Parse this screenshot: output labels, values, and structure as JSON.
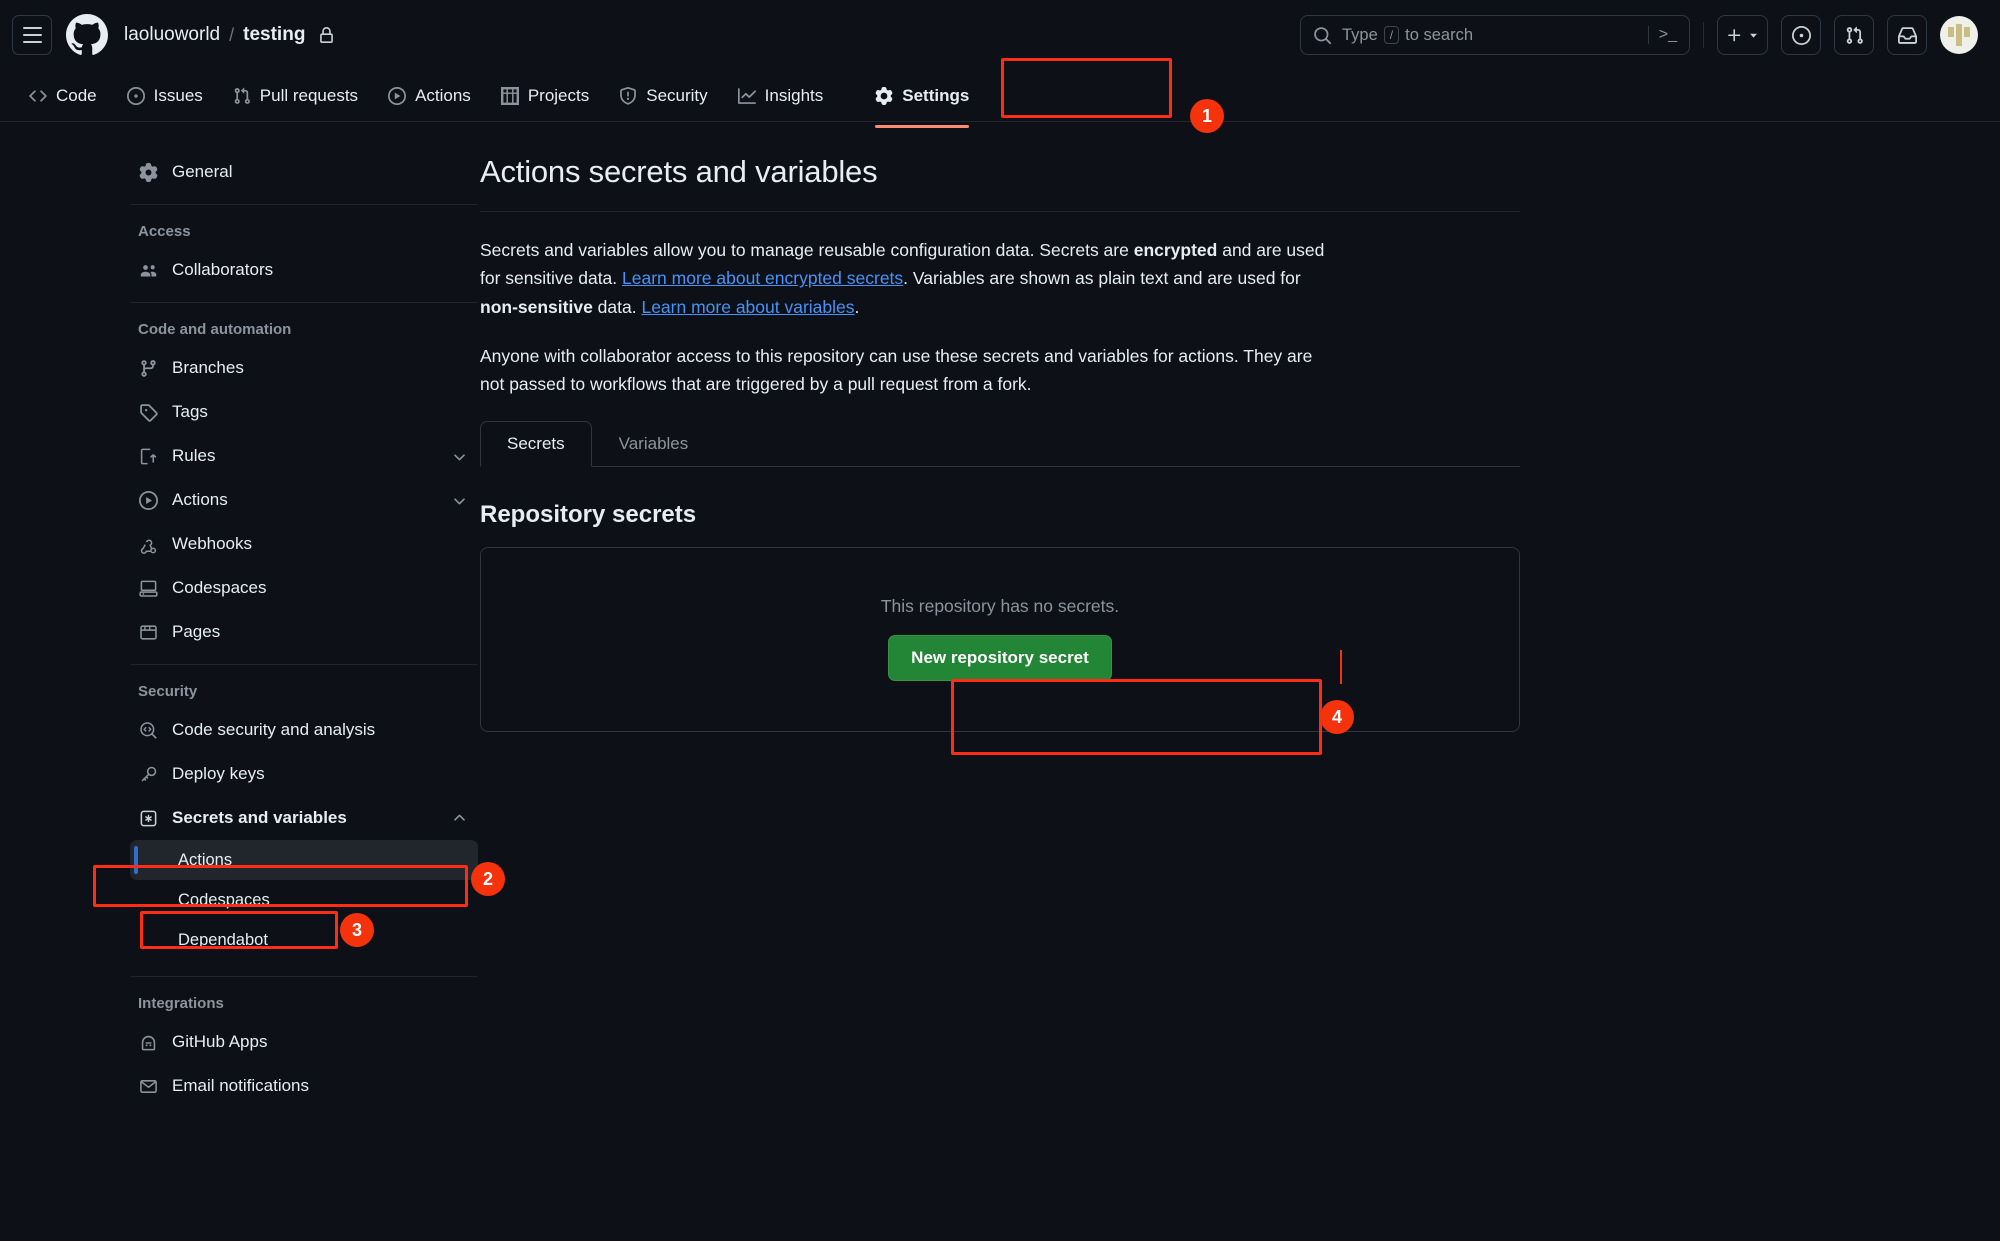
{
  "header": {
    "hamburger": "menu-icon",
    "owner": "laoluoworld",
    "separator": "/",
    "repo": "testing",
    "visibility_icon": "lock-icon",
    "search_placeholder_pre": "Type",
    "search_key": "/",
    "search_placeholder_post": "to search",
    "command_palette_icon": ">_",
    "create_new_label": "+",
    "issues_icon": "issue-opened-icon",
    "pulls_icon": "git-pull-request-icon",
    "inbox_icon": "inbox-icon",
    "avatar_label": "avatar"
  },
  "repo_nav": {
    "items": [
      {
        "label": "Code",
        "icon": "code-icon",
        "selected": false
      },
      {
        "label": "Issues",
        "icon": "issue-opened-icon",
        "selected": false
      },
      {
        "label": "Pull requests",
        "icon": "git-pull-request-icon",
        "selected": false
      },
      {
        "label": "Actions",
        "icon": "play-icon",
        "selected": false
      },
      {
        "label": "Projects",
        "icon": "table-icon",
        "selected": false
      },
      {
        "label": "Security",
        "icon": "shield-icon",
        "selected": false
      },
      {
        "label": "Insights",
        "icon": "graph-icon",
        "selected": false
      },
      {
        "label": "Settings",
        "icon": "gear-icon",
        "selected": true
      }
    ]
  },
  "sidebar": {
    "general": {
      "label": "General",
      "icon": "gear-icon"
    },
    "sections": [
      {
        "title": "Access",
        "items": [
          {
            "label": "Collaborators",
            "icon": "people-icon",
            "chevron": ""
          }
        ]
      },
      {
        "title": "Code and automation",
        "items": [
          {
            "label": "Branches",
            "icon": "git-branch-icon",
            "chevron": ""
          },
          {
            "label": "Tags",
            "icon": "tag-icon",
            "chevron": ""
          },
          {
            "label": "Rules",
            "icon": "rules-icon",
            "chevron": "down"
          },
          {
            "label": "Actions",
            "icon": "play-icon",
            "chevron": "down"
          },
          {
            "label": "Webhooks",
            "icon": "webhook-icon",
            "chevron": ""
          },
          {
            "label": "Codespaces",
            "icon": "codespaces-icon",
            "chevron": ""
          },
          {
            "label": "Pages",
            "icon": "browser-icon",
            "chevron": ""
          }
        ]
      },
      {
        "title": "Security",
        "items": [
          {
            "label": "Code security and analysis",
            "icon": "codescan-icon",
            "chevron": ""
          },
          {
            "label": "Deploy keys",
            "icon": "key-icon",
            "chevron": ""
          },
          {
            "label": "Secrets and variables",
            "icon": "asterisk-key-icon",
            "chevron": "up",
            "bold": true
          }
        ],
        "subitems": [
          {
            "label": "Actions",
            "active": true
          },
          {
            "label": "Codespaces",
            "active": false
          },
          {
            "label": "Dependabot",
            "active": false
          }
        ]
      },
      {
        "title": "Integrations",
        "items": [
          {
            "label": "GitHub Apps",
            "icon": "github-apps-icon",
            "chevron": ""
          },
          {
            "label": "Email notifications",
            "icon": "mail-icon",
            "chevron": ""
          }
        ]
      }
    ]
  },
  "main": {
    "title": "Actions secrets and variables",
    "paragraph1": {
      "part1": "Secrets and variables allow you to manage reusable configuration data. Secrets are ",
      "bold1": "encrypted",
      "part2": " and are used for sensitive data. ",
      "link1": "Learn more about encrypted secrets",
      "part3": ". Variables are shown as plain text and are used for ",
      "bold2": "non-sensitive",
      "part4": " data. ",
      "link2": "Learn more about variables",
      "part5": "."
    },
    "paragraph2": "Anyone with collaborator access to this repository can use these secrets and variables for actions. They are not passed to workflows that are triggered by a pull request from a fork.",
    "tabs": [
      {
        "label": "Secrets",
        "active": true
      },
      {
        "label": "Variables",
        "active": false
      }
    ],
    "section_title": "Repository secrets",
    "empty_message": "This repository has no secrets.",
    "new_secret_button": "New repository secret"
  },
  "annotations": {
    "accent_color": "#ff2d16",
    "badge_color": "#f4320c",
    "badges": [
      {
        "number": "1",
        "target": "settings-tab"
      },
      {
        "number": "2",
        "target": "secrets-and-variables-sidebar-item"
      },
      {
        "number": "3",
        "target": "actions-subitem"
      },
      {
        "number": "4",
        "target": "new-repository-secret-button"
      }
    ]
  },
  "colors": {
    "background": "#0d1117",
    "green_button": "#238636",
    "link": "#4493f8",
    "selected_tab_underline": "#fd8c73",
    "active_subitem_indicator": "#316dca"
  }
}
